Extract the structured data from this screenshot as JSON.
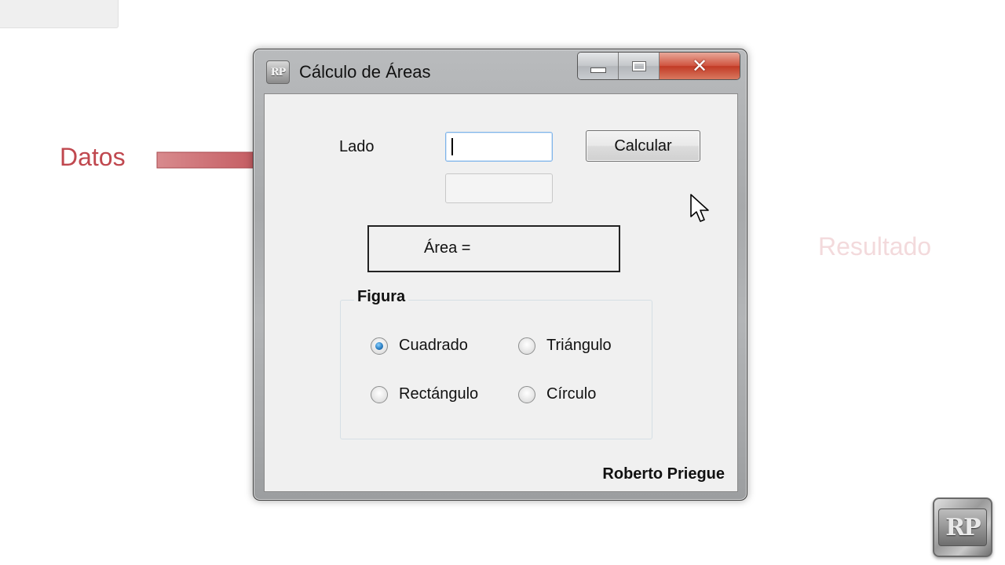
{
  "annotations": {
    "datos": "Datos",
    "resultado": "Resultado"
  },
  "window": {
    "title": "Cálculo de Áreas",
    "icon_text": "RP",
    "controls": {
      "minimize_icon": "minimize-icon",
      "maximize_icon": "maximize-icon",
      "close_icon": "close-icon",
      "close_glyph": "✕"
    },
    "form": {
      "lado_label": "Lado",
      "lado_value": "",
      "calculate_button": "Calcular",
      "area_label": "Área =",
      "group_title": "Figura",
      "options": [
        {
          "label": "Cuadrado",
          "checked": true
        },
        {
          "label": "Triángulo",
          "checked": false
        },
        {
          "label": "Rectángulo",
          "checked": false
        },
        {
          "label": "Círculo",
          "checked": false
        }
      ],
      "author": "Roberto  Priegue"
    }
  },
  "logo_text": "RP",
  "colors": {
    "annotation_red": "#c0484f",
    "annotation_faded": "#f3dadc",
    "close_button": "#c13a25",
    "radio_selected": "#2b7fc3"
  }
}
